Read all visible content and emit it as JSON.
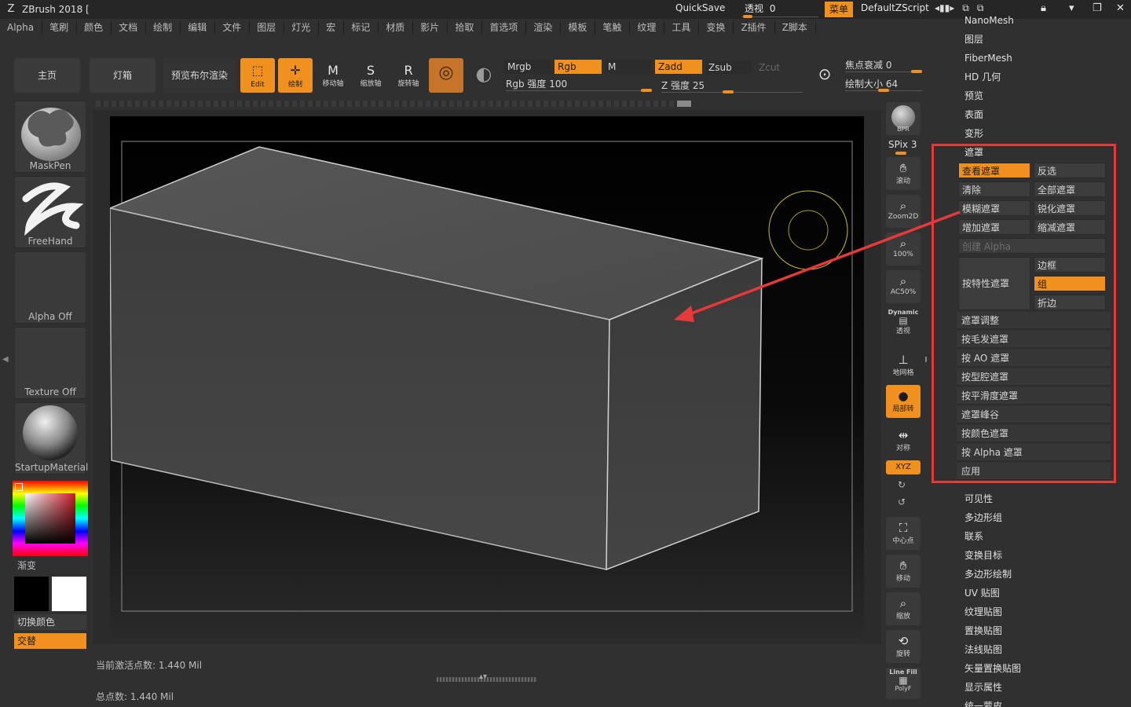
{
  "titlebar": {
    "title": "ZBrush 2018 [",
    "quicksave": "QuickSave",
    "perspective_label": "透视",
    "perspective_value": "0",
    "menu_label": "菜单",
    "script_label": "DefaultZScript"
  },
  "menubar": [
    "Alpha",
    "笔刷",
    "颜色",
    "文档",
    "绘制",
    "编辑",
    "文件",
    "图层",
    "灯光",
    "宏",
    "标记",
    "材质",
    "影片",
    "拾取",
    "首选项",
    "渲染",
    "模板",
    "笔触",
    "纹理",
    "工具",
    "变换",
    "Z插件",
    "Z脚本"
  ],
  "toolbar": {
    "home": "主页",
    "lightbox": "灯箱",
    "boolean_preview": "预览布尔渲染",
    "edit": "Edit",
    "draw": "绘制",
    "move": "移动轴",
    "scale": "缩放轴",
    "rotate": "旋转轴",
    "mrgb": "Mrgb",
    "rgb": "Rgb",
    "m": "M",
    "zadd": "Zadd",
    "zsub": "Zsub",
    "zcut": "Zcut",
    "rgb_intensity": "Rgb 强度 100",
    "z_intensity": "Z 强度 25",
    "focal_shift": "焦点衰减 0",
    "draw_size": "绘制大小 64"
  },
  "left_tray": {
    "brush": "MaskPen",
    "stroke": "FreeHand",
    "alpha": "Alpha Off",
    "texture": "Texture Off",
    "material": "StartupMaterial",
    "gradient": "渐变",
    "switch_color": "切换颜色",
    "alternate": "交替"
  },
  "right_tools": {
    "bpr": "BPR",
    "spix": "SPix 3",
    "scroll": "滚动",
    "zoom2d": "Zoom2D",
    "zoom100": "100%",
    "ac50": "AC50%",
    "dynamic": "Dynamic",
    "persp": "透视",
    "floor": "地网格",
    "local": "局部转",
    "symmetry": "对称",
    "xyz": "XYZ",
    "center": "中心点",
    "move": "移动",
    "scale": "缩放",
    "rotate": "旋转",
    "linefill": "Line Fill",
    "polyf": "PolyF"
  },
  "palette": {
    "top_items": [
      "NanoMesh",
      "图层",
      "FiberMesh",
      "HD 几何",
      "预览",
      "表面",
      "变形",
      "遮罩"
    ],
    "mask_buttons": {
      "view_mask": "查看遮罩",
      "invert": "反选",
      "clear": "清除",
      "mask_all": "全部遮罩",
      "blur": "模糊遮罩",
      "sharpen": "锐化遮罩",
      "grow": "增加遮罩",
      "shrink": "缩减遮罩",
      "create_alpha": "创建 Alpha",
      "mask_by_feature": "按特性遮罩",
      "border": "边框",
      "groups": "组",
      "crease": "折边"
    },
    "mask_rows": [
      "遮罩调整",
      "按毛发遮罩",
      "按 AO 遮罩",
      "按型腔遮罩",
      "按平滑度遮罩",
      "遮罩峰谷",
      "按颜色遮罩",
      "按 Alpha 遮罩",
      "应用"
    ],
    "bottom_items": [
      "可见性",
      "多边形组",
      "联系",
      "变换目标",
      "多边形绘制",
      "UV 贴图",
      "纹理贴图",
      "置换贴图",
      "法线贴图",
      "矢量置换贴图",
      "显示属性",
      "统一蒙皮"
    ]
  },
  "status": {
    "active_points": "当前激活点数: 1.440 Mil",
    "total_points": "总点数: 1.440 Mil"
  },
  "colors": {
    "accent": "#f0901e",
    "annotation": "#e63a3a"
  }
}
